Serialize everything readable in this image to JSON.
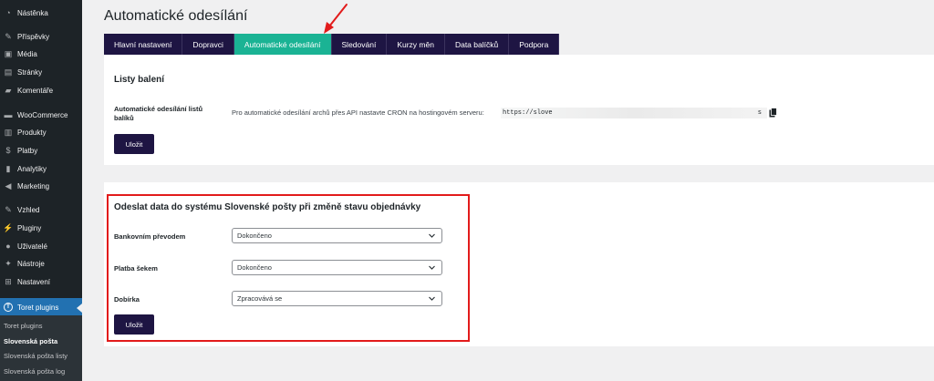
{
  "sidebar": {
    "items": [
      {
        "label": "Nástěnka",
        "icon": "dashboard-icon",
        "glyph": "◔"
      },
      {
        "label": "Příspěvky",
        "icon": "pushpin-icon",
        "glyph": "✎"
      },
      {
        "label": "Média",
        "icon": "media-icon",
        "glyph": "▣"
      },
      {
        "label": "Stránky",
        "icon": "pages-icon",
        "glyph": "▤"
      },
      {
        "label": "Komentáře",
        "icon": "comments-icon",
        "glyph": "▰"
      },
      {
        "label": "WooCommerce",
        "icon": "woocommerce-icon",
        "glyph": "▬"
      },
      {
        "label": "Produkty",
        "icon": "products-icon",
        "glyph": "▥"
      },
      {
        "label": "Platby",
        "icon": "payments-icon",
        "glyph": "$"
      },
      {
        "label": "Analytiky",
        "icon": "analytics-icon",
        "glyph": "▮"
      },
      {
        "label": "Marketing",
        "icon": "megaphone-icon",
        "glyph": "◀"
      },
      {
        "label": "Vzhled",
        "icon": "appearance-icon",
        "glyph": "✎"
      },
      {
        "label": "Pluginy",
        "icon": "plugins-icon",
        "glyph": "⚡"
      },
      {
        "label": "Uživatelé",
        "icon": "users-icon",
        "glyph": "●"
      },
      {
        "label": "Nástroje",
        "icon": "tools-icon",
        "glyph": "✦"
      },
      {
        "label": "Nastavení",
        "icon": "settings-icon",
        "glyph": "⊞"
      },
      {
        "label": "Toret plugins",
        "icon": "toret-icon",
        "glyph": "T"
      }
    ],
    "submenu": [
      "Toret plugins",
      "Slovenská pošta",
      "Slovenská pošta listy",
      "Slovenská pošta log"
    ]
  },
  "page": {
    "title": "Automatické odesílání"
  },
  "tabs": [
    "Hlavní nastavení",
    "Dopravci",
    "Automatické odesílání",
    "Sledování",
    "Kurzy měn",
    "Data balíčků",
    "Podpora"
  ],
  "panel1": {
    "heading": "Listy balení",
    "label": "Automatické odesílání listů balíků",
    "description": "Pro automatické odesílání archů přes API nastavte CRON na hostingovém serveru:",
    "url_start": "https://slove",
    "url_end": "s",
    "button": "Uložit"
  },
  "panel2": {
    "heading": "Odeslat data do systému Slovenské pošty při změně stavu objednávky",
    "rows": [
      {
        "label": "Bankovním převodem",
        "value": "Dokončeno"
      },
      {
        "label": "Platba šekem",
        "value": "Dokončeno"
      },
      {
        "label": "Dobírka",
        "value": "Zpracovává se"
      }
    ],
    "button": "Uložit"
  },
  "colors": {
    "accent": "#1ab394",
    "button": "#1e1543",
    "highlight": "#e21b1b",
    "arrow": "#e21b1b",
    "sidebar": "#1d2327",
    "sidebar_active": "#2271b1"
  }
}
